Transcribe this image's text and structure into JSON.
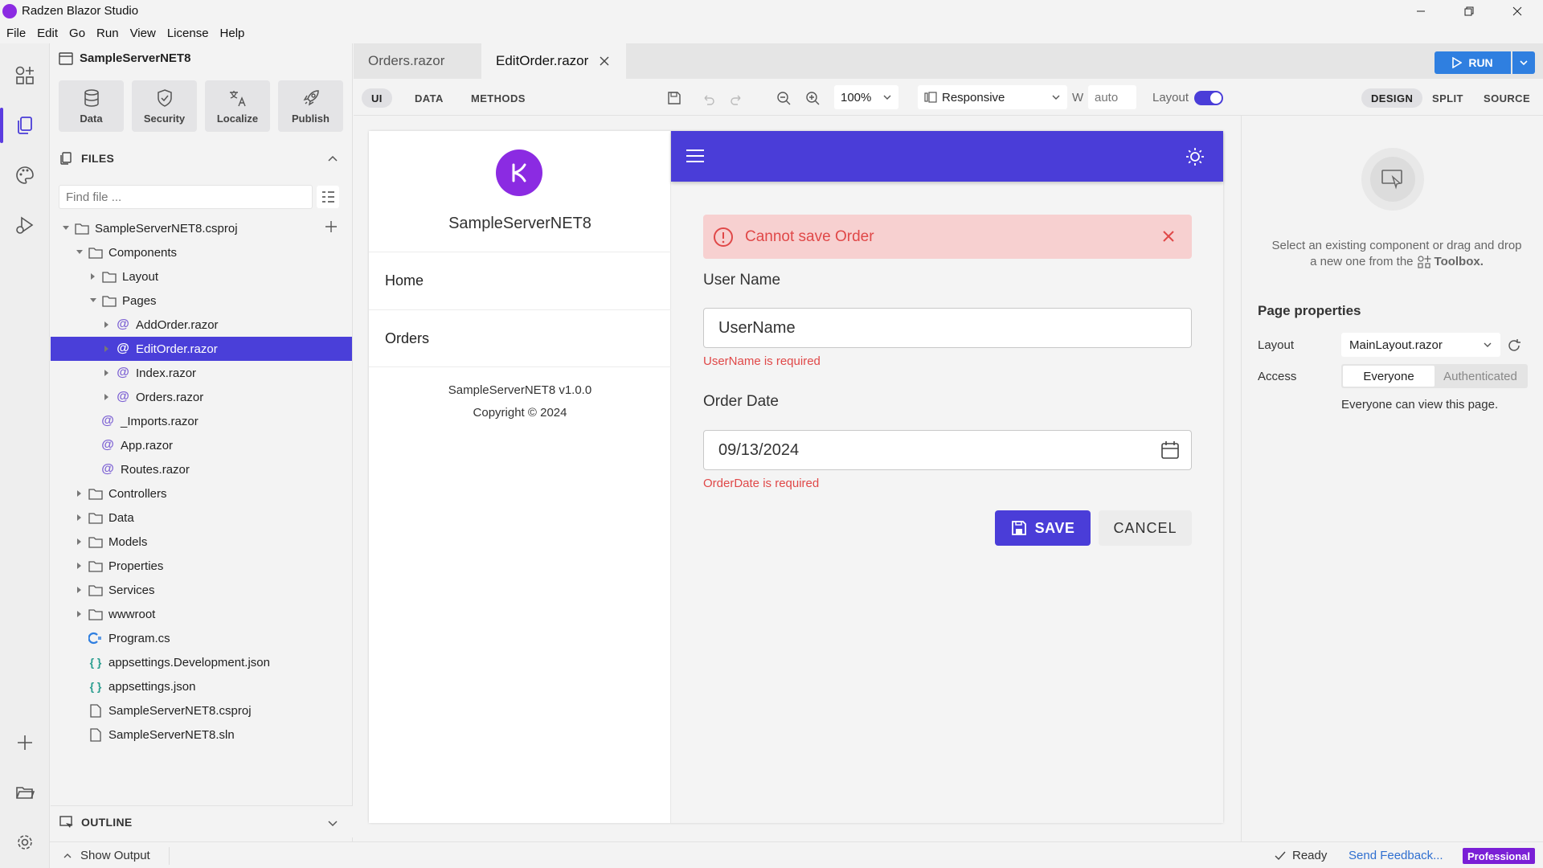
{
  "app": {
    "title": "Radzen Blazor Studio"
  },
  "menu": [
    "File",
    "Edit",
    "Go",
    "Run",
    "View",
    "License",
    "Help"
  ],
  "sidebar": {
    "project_title": "SampleServerNET8",
    "tools": [
      {
        "label": "Data",
        "icon": "database-icon"
      },
      {
        "label": "Security",
        "icon": "shield-icon"
      },
      {
        "label": "Localize",
        "icon": "translate-icon"
      },
      {
        "label": "Publish",
        "icon": "rocket-icon"
      }
    ],
    "files_header": "FILES",
    "find_placeholder": "Find file ...",
    "tree": [
      {
        "label": "SampleServerNET8.csproj",
        "type": "folder",
        "depth": 0,
        "open": true
      },
      {
        "label": "Components",
        "type": "folder",
        "depth": 1,
        "open": true
      },
      {
        "label": "Layout",
        "type": "folder",
        "depth": 2,
        "open": false
      },
      {
        "label": "Pages",
        "type": "folder",
        "depth": 2,
        "open": true
      },
      {
        "label": "AddOrder.razor",
        "type": "razor",
        "depth": 3,
        "expandable": true
      },
      {
        "label": "EditOrder.razor",
        "type": "razor",
        "depth": 3,
        "expandable": true,
        "selected": true
      },
      {
        "label": "Index.razor",
        "type": "razor",
        "depth": 3,
        "expandable": true
      },
      {
        "label": "Orders.razor",
        "type": "razor",
        "depth": 3,
        "expandable": true
      },
      {
        "label": "_Imports.razor",
        "type": "razor",
        "depth": 2,
        "expandable": false
      },
      {
        "label": "App.razor",
        "type": "razor",
        "depth": 2,
        "expandable": false
      },
      {
        "label": "Routes.razor",
        "type": "razor",
        "depth": 2,
        "expandable": false
      },
      {
        "label": "Controllers",
        "type": "folder",
        "depth": 1,
        "open": false
      },
      {
        "label": "Data",
        "type": "folder",
        "depth": 1,
        "open": false
      },
      {
        "label": "Models",
        "type": "folder",
        "depth": 1,
        "open": false
      },
      {
        "label": "Properties",
        "type": "folder",
        "depth": 1,
        "open": false
      },
      {
        "label": "Services",
        "type": "folder",
        "depth": 1,
        "open": false
      },
      {
        "label": "wwwroot",
        "type": "folder",
        "depth": 1,
        "open": false
      },
      {
        "label": "Program.cs",
        "type": "csharp",
        "depth": 1
      },
      {
        "label": "appsettings.Development.json",
        "type": "json",
        "depth": 1
      },
      {
        "label": "appsettings.json",
        "type": "json",
        "depth": 1
      },
      {
        "label": "SampleServerNET8.csproj",
        "type": "file",
        "depth": 1
      },
      {
        "label": "SampleServerNET8.sln",
        "type": "file",
        "depth": 1
      }
    ],
    "outline_header": "OUTLINE"
  },
  "tabs": [
    {
      "label": "Orders.razor",
      "active": false
    },
    {
      "label": "EditOrder.razor",
      "active": true
    }
  ],
  "run_label": "RUN",
  "toolbar": {
    "modes": [
      "UI",
      "DATA",
      "METHODS"
    ],
    "zoom": "100%",
    "device": "Responsive",
    "width_label": "W",
    "width_value": "auto",
    "layout_label": "Layout",
    "layout_on": true,
    "views": [
      "DESIGN",
      "SPLIT",
      "SOURCE"
    ]
  },
  "canvas": {
    "brand": "SampleServerNET8",
    "nav": [
      "Home",
      "Orders"
    ],
    "version": "SampleServerNET8 v1.0.0",
    "copyright": "Copyright © 2024",
    "alert": "Cannot save Order",
    "username_label": "User Name",
    "username_value": "UserName",
    "username_error": "UserName is required",
    "orderdate_label": "Order Date",
    "orderdate_value": "09/13/2024",
    "orderdate_error": "OrderDate is required",
    "save_label": "SAVE",
    "cancel_label": "CANCEL"
  },
  "right": {
    "hint_line1": "Select an existing component or drag and drop",
    "hint_line2_pre": "a new one from the",
    "hint_toolbox": "Toolbox.",
    "page_props": "Page properties",
    "layout_label": "Layout",
    "layout_value": "MainLayout.razor",
    "access_label": "Access",
    "access_options": [
      "Everyone",
      "Authenticated"
    ],
    "access_note": "Everyone can view this page."
  },
  "status": {
    "show_output": "Show Output",
    "ready": "Ready",
    "feedback": "Send Feedback...",
    "edition": "Professional"
  },
  "colors": {
    "accent": "#4a3dd8",
    "brand": "#8b2be2",
    "run": "#2f7fe0",
    "error": "#e04848"
  }
}
